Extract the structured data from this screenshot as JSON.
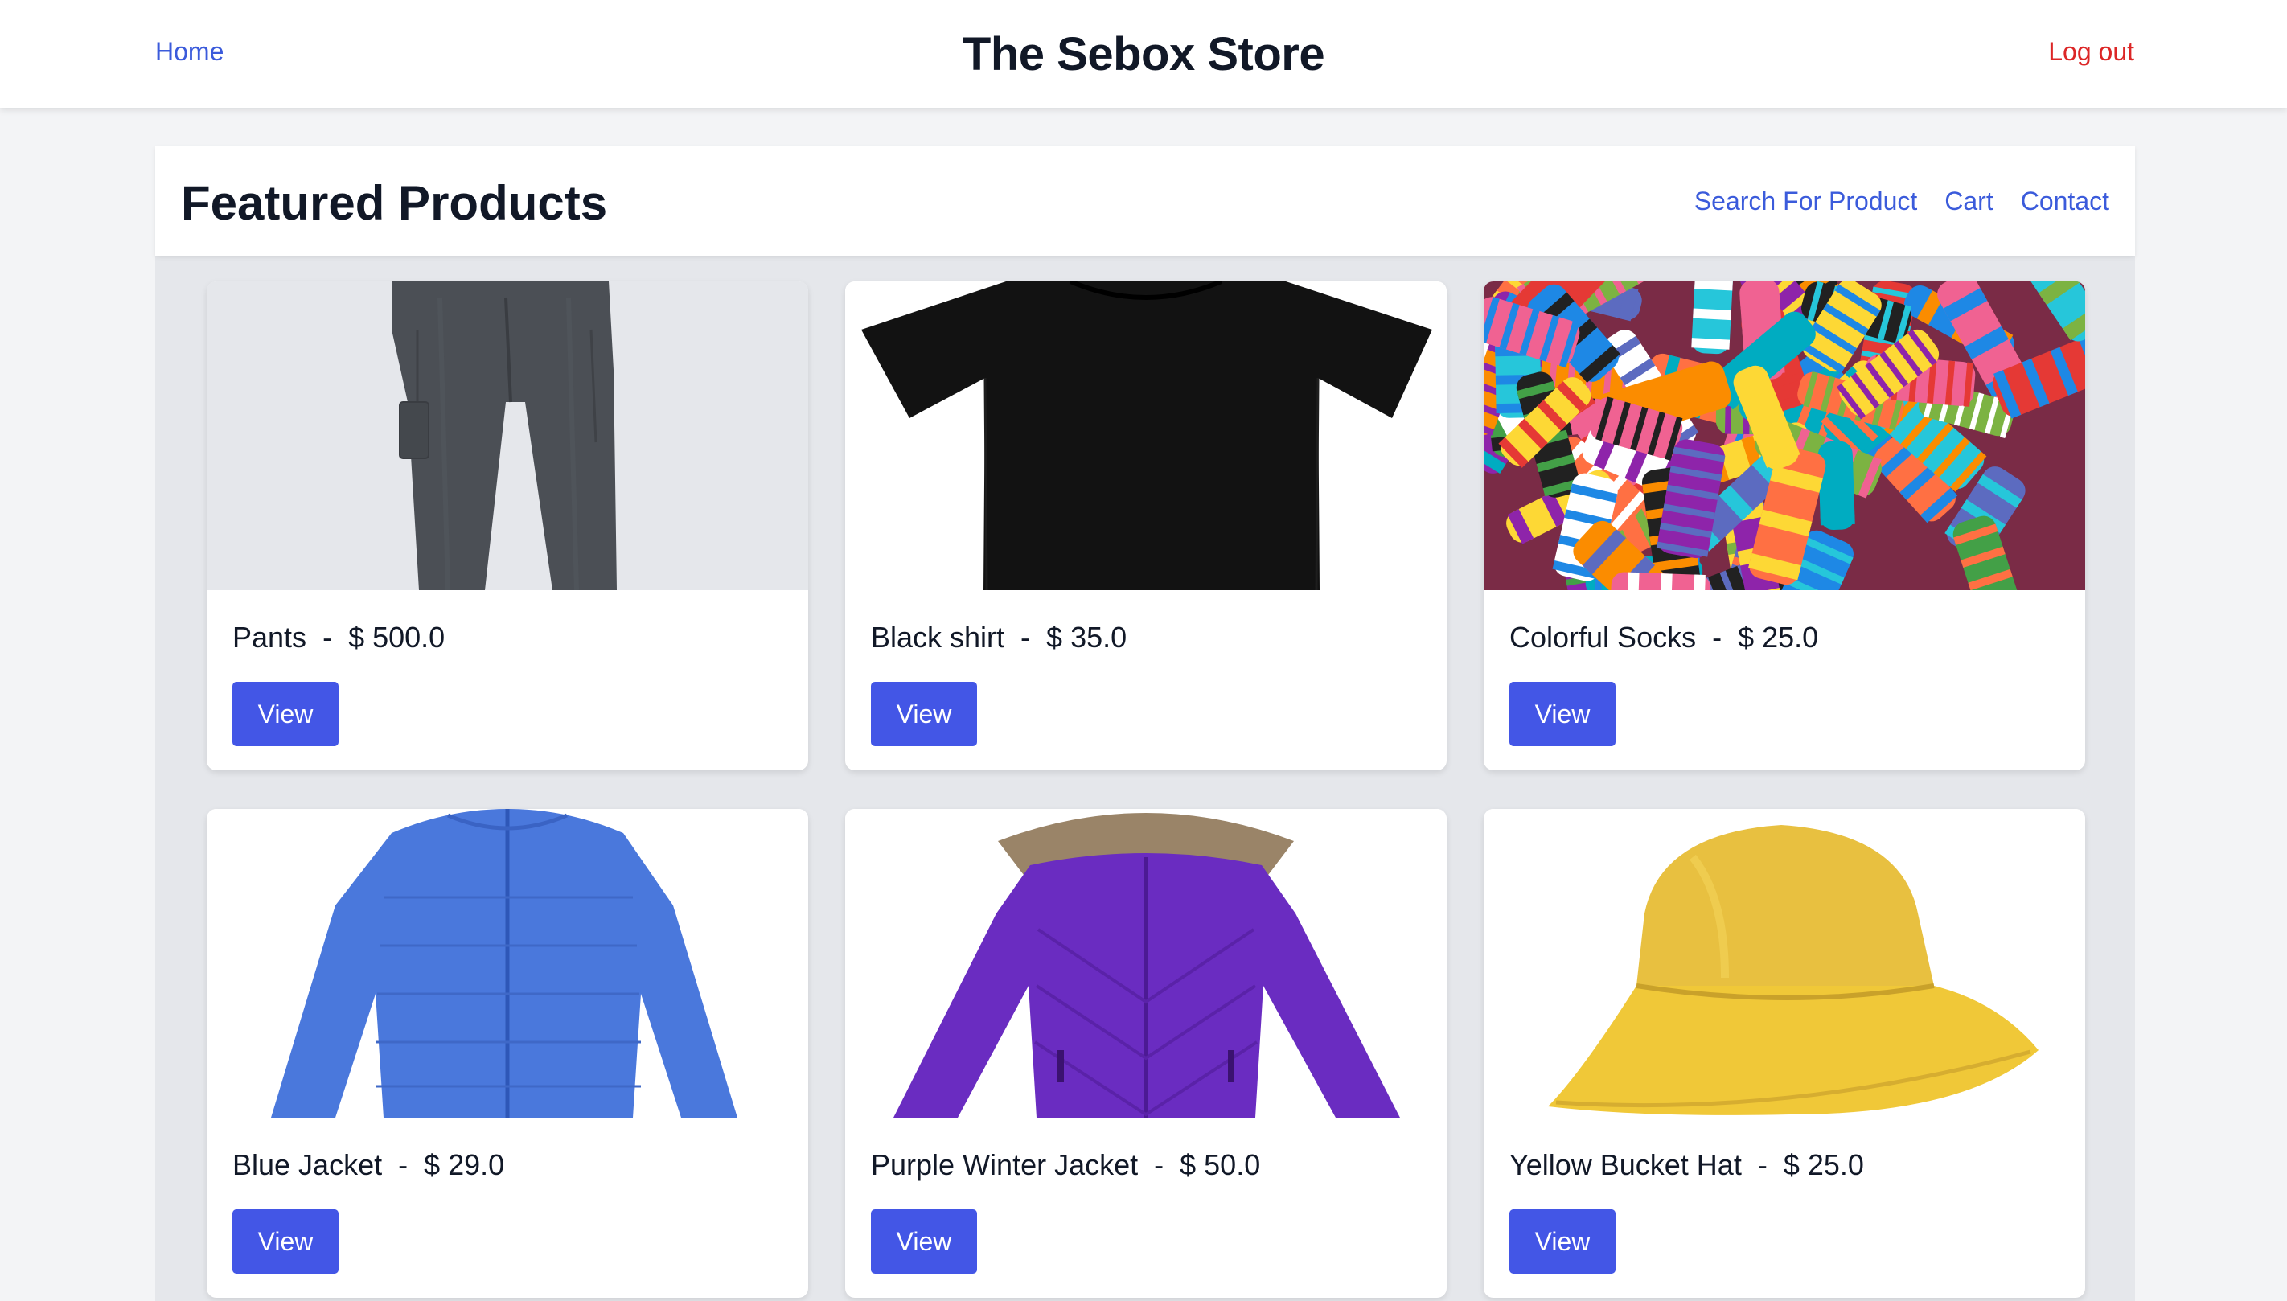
{
  "nav": {
    "home_label": "Home",
    "store_title": "The Sebox Store",
    "logout_label": "Log out"
  },
  "panel": {
    "heading": "Featured Products",
    "links": [
      "Search For Product",
      "Cart",
      "Contact"
    ]
  },
  "products": [
    {
      "name": "Pants",
      "price": "$ 500.0",
      "image": "gray-pants",
      "view_label": "View"
    },
    {
      "name": "Black shirt",
      "price": "$ 35.0",
      "image": "black-tshirt",
      "view_label": "View"
    },
    {
      "name": "Colorful Socks",
      "price": "$ 25.0",
      "image": "colorful-socks",
      "view_label": "View"
    },
    {
      "name": "Blue Jacket",
      "price": "$ 29.0",
      "image": "blue-puffer-jacket",
      "view_label": "View"
    },
    {
      "name": "Purple Winter Jacket",
      "price": "$ 50.0",
      "image": "purple-winter-jacket",
      "view_label": "View"
    },
    {
      "name": "Yellow Bucket Hat",
      "price": "$ 25.0",
      "image": "yellow-bucket-hat",
      "view_label": "View"
    }
  ],
  "colors": {
    "link": "#3b5bdb",
    "logout": "#dc2626",
    "button": "#4356e6",
    "background": "#f3f4f6",
    "panel": "#e5e7eb"
  }
}
